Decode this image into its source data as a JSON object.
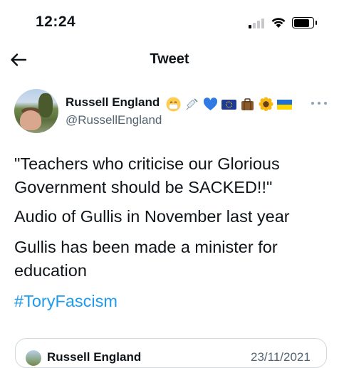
{
  "status_bar": {
    "time": "12:24"
  },
  "nav": {
    "title": "Tweet"
  },
  "tweet": {
    "author": {
      "display_name": "Russell England",
      "handle": "@RussellEngland",
      "emoji_icons": [
        "mask-face-icon",
        "syringe-icon",
        "blue-heart-icon",
        "eu-flag-icon",
        "suitcase-icon",
        "sunflower-icon",
        "ukraine-flag-icon"
      ]
    },
    "text": {
      "quote_line": "\"Teachers who criticise our Glorious Government should be SACKED!!\"",
      "line2": "Audio of Gullis in November last year",
      "line3": "Gullis has been made a minister for education",
      "hashtag": "#ToryFascism"
    }
  },
  "quoted_tweet": {
    "display_name": "Russell England",
    "date": "23/11/2021"
  },
  "colors": {
    "link": "#1d9bf0",
    "text": "#0f1419",
    "secondary": "#536471",
    "border": "#cfd9de"
  }
}
